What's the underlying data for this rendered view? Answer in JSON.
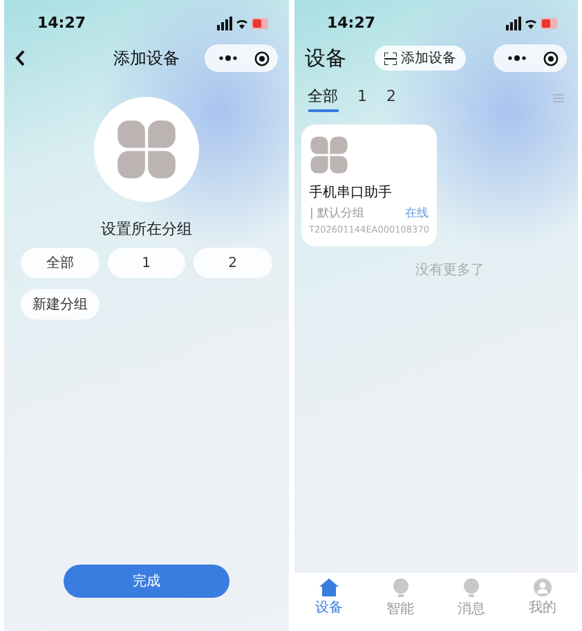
{
  "left": {
    "status_time": "14:27",
    "title": "添加设备",
    "group_label": "设置所在分组",
    "groups": [
      {
        "label": "全部"
      },
      {
        "label": "1"
      },
      {
        "label": "2"
      }
    ],
    "new_group": "新建分组",
    "done": "完成"
  },
  "right": {
    "status_time": "14:27",
    "title": "设备",
    "add_button": "添加设备",
    "tabs": [
      {
        "label": "全部",
        "selected": true
      },
      {
        "label": "1",
        "selected": false
      },
      {
        "label": "2",
        "selected": false
      }
    ],
    "device": {
      "name": "手机串口助手",
      "group": "| 默认分组",
      "status": "在线",
      "id": "T202601144EA000108370"
    },
    "end_text": "没有更多了",
    "nav": [
      {
        "label": "设备",
        "kind": "home",
        "selected": true
      },
      {
        "label": "智能",
        "kind": "bulb",
        "selected": false
      },
      {
        "label": "消息",
        "kind": "bulb",
        "selected": false
      },
      {
        "label": "我的",
        "kind": "user",
        "selected": false
      }
    ]
  }
}
